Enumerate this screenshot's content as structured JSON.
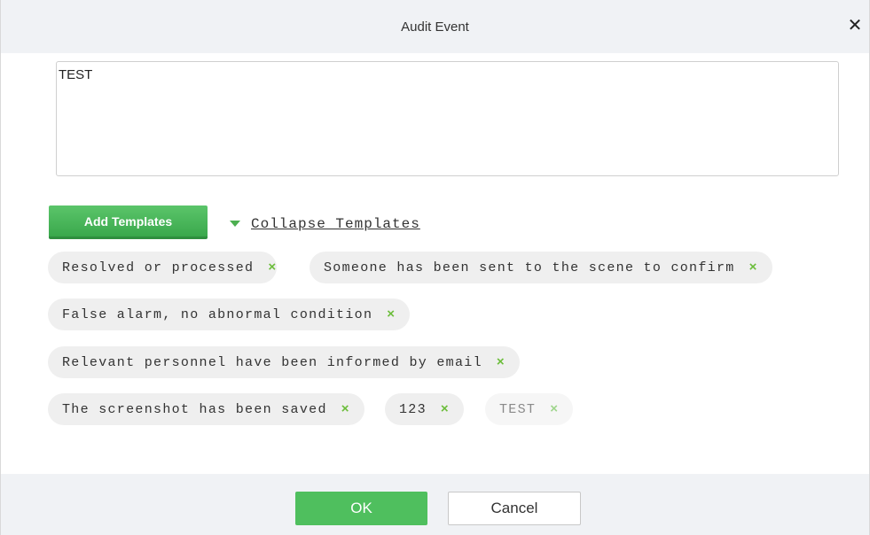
{
  "dialog": {
    "title": "Audit Event",
    "close_icon": "close-icon",
    "close_glyph": "✕"
  },
  "content": {
    "textarea_value": "TEST"
  },
  "templates": {
    "add_label": "Add Templates",
    "collapse_label": "Collapse Templates",
    "collapse_icon": "caret-down-icon",
    "accent_color": "#4caf50",
    "items": [
      {
        "label": "Resolved or processed",
        "remove": "×"
      },
      {
        "label": "Someone has been sent to the scene to confirm",
        "remove": "×"
      },
      {
        "label": "False alarm, no abnormal condition",
        "remove": "×"
      },
      {
        "label": "Relevant personnel have been informed by email",
        "remove": "×"
      },
      {
        "label": "The screenshot has been saved",
        "remove": "×"
      },
      {
        "label": "123",
        "remove": "×"
      },
      {
        "label": "TEST",
        "remove": "×"
      }
    ]
  },
  "footer": {
    "ok_label": "OK",
    "cancel_label": "Cancel",
    "ok_color": "#4fbf5e"
  }
}
